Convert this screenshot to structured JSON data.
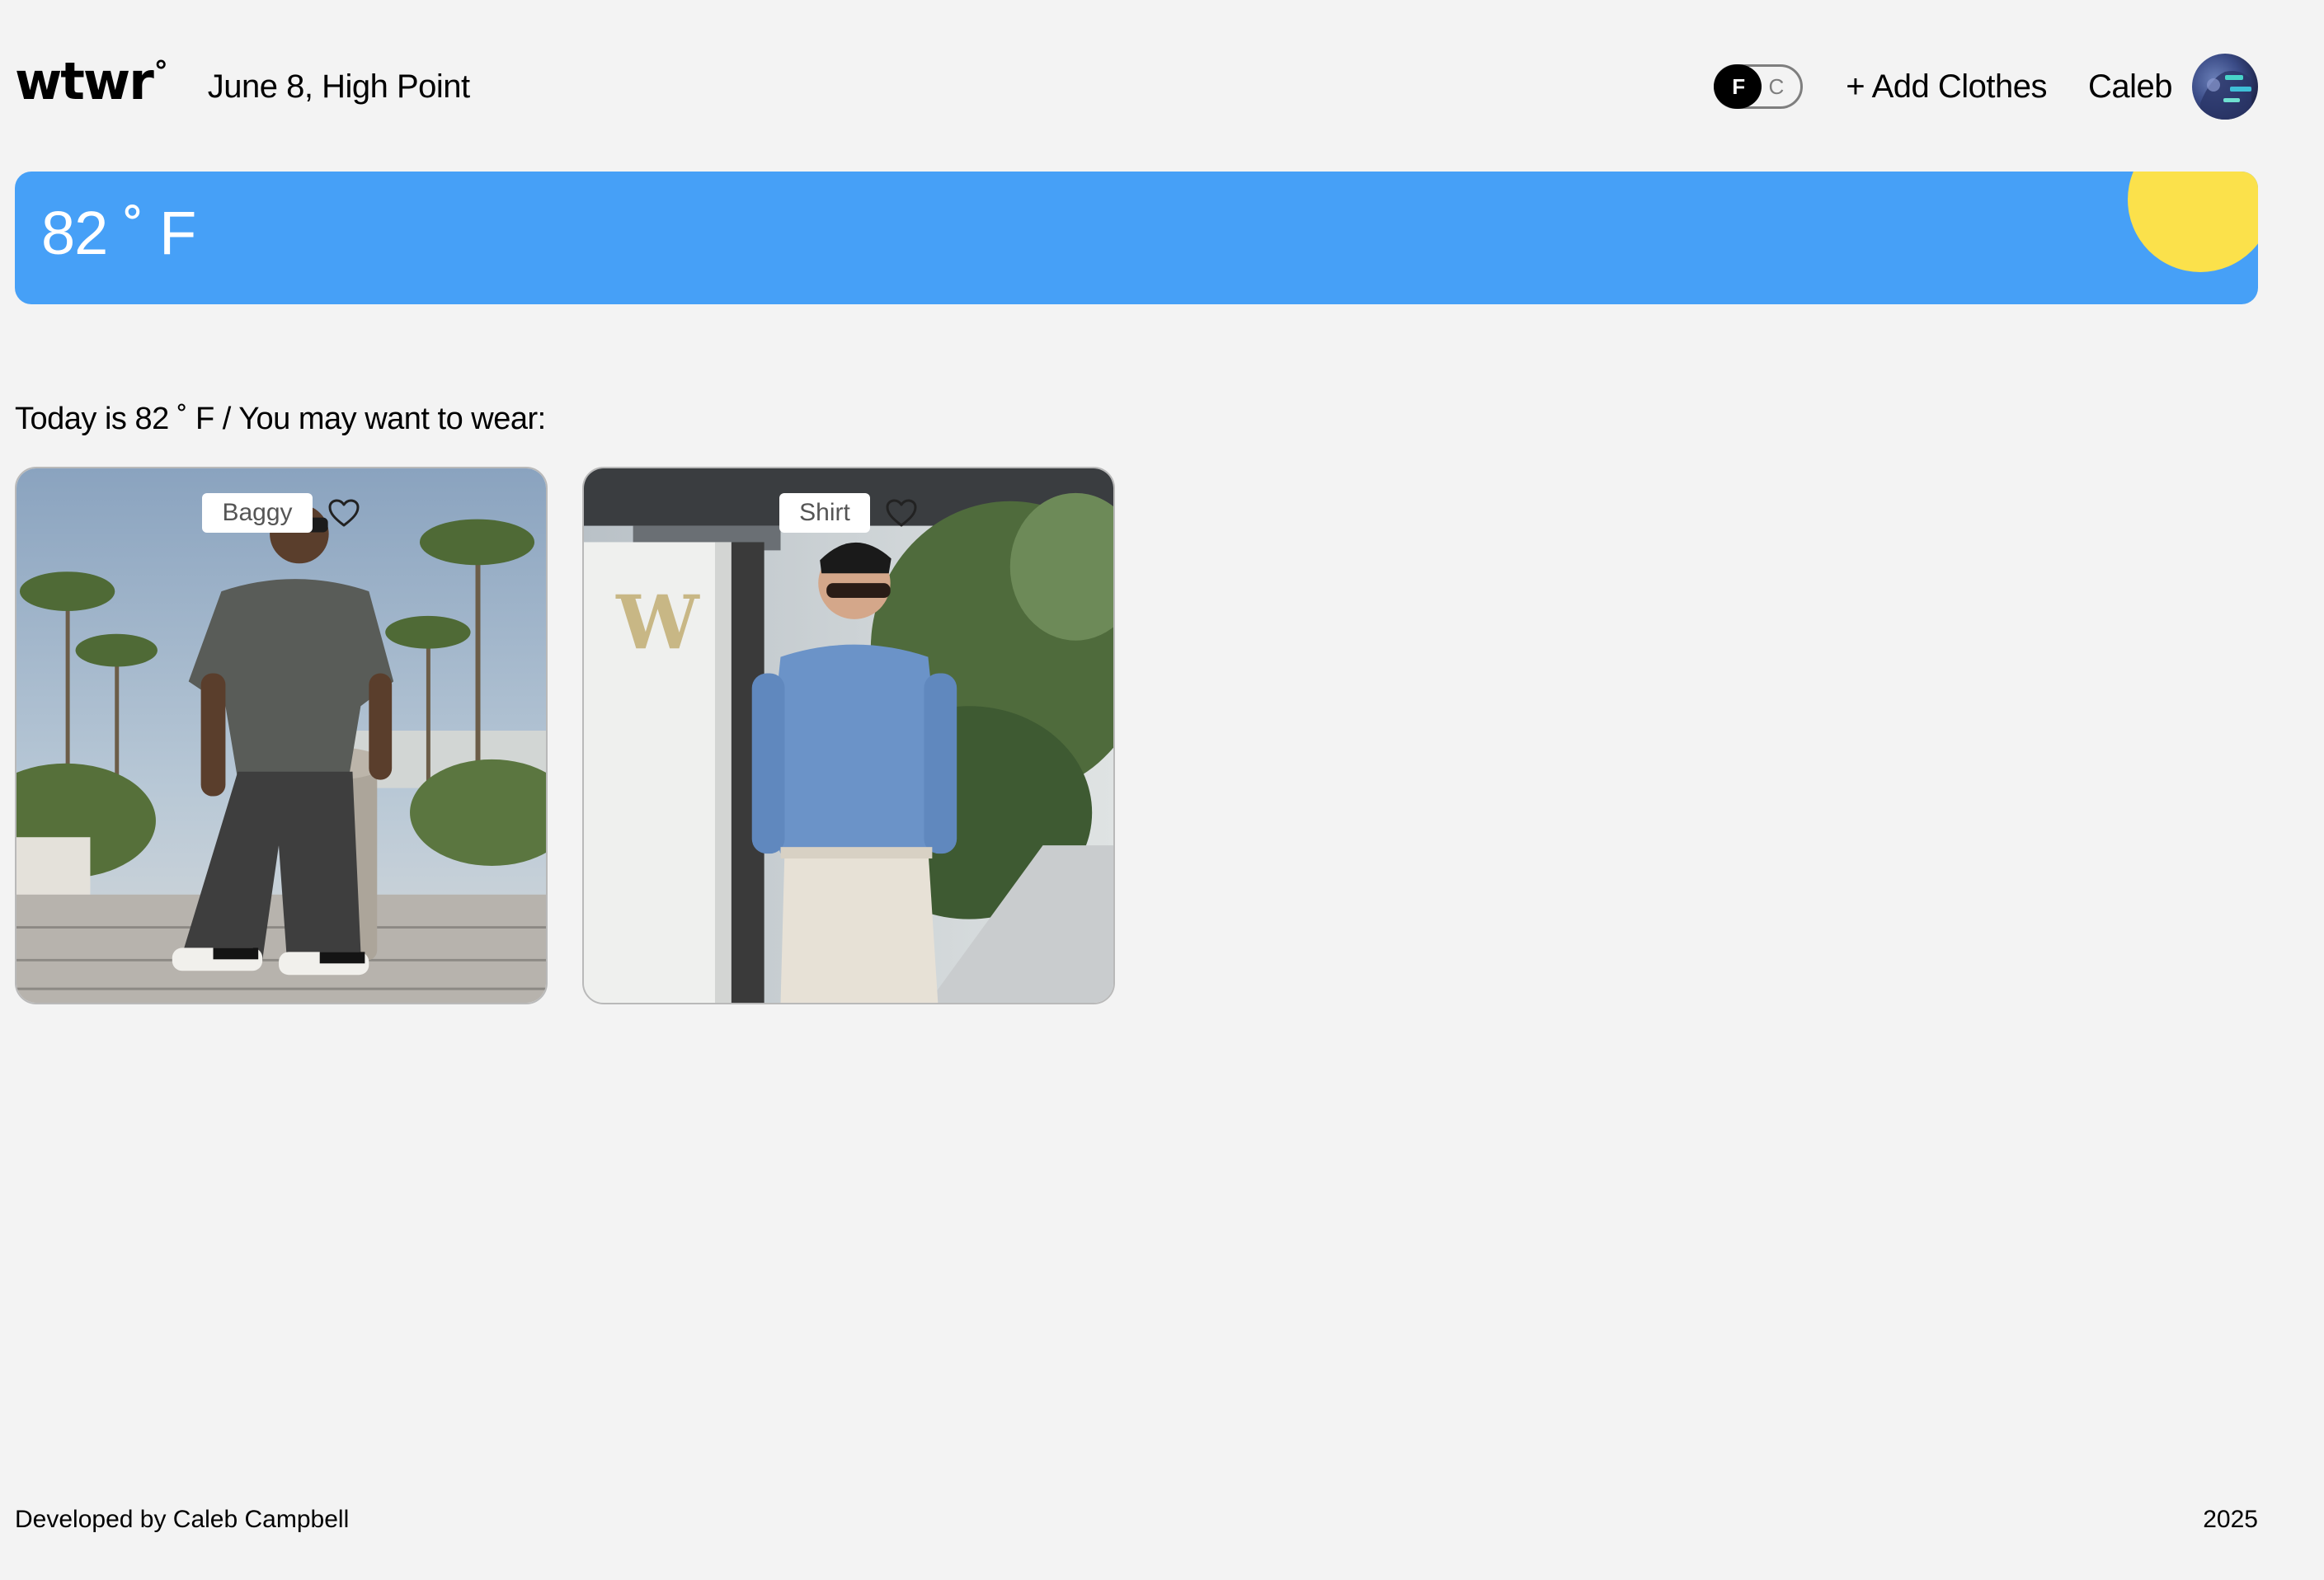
{
  "header": {
    "logo": "wtwr",
    "logo_mark": "°",
    "date_location": "June 8, High Point",
    "toggle": {
      "f_label": "F",
      "c_label": "C"
    },
    "add_clothes_label": "+ Add Clothes",
    "username": "Caleb"
  },
  "weather": {
    "temperature": "82 ˚ F"
  },
  "suggestion": "Today is 82 ˚ F / You may want to wear:",
  "cards": [
    {
      "name": "Baggy"
    },
    {
      "name": "Shirt"
    }
  ],
  "footer": {
    "developer": "Developed by Caleb Campbell",
    "year": "2025"
  },
  "colors": {
    "background": "#f3f3f3",
    "weather_card": "#46a0f7",
    "sun": "#fbe14b",
    "toggle_active": "#000000"
  }
}
